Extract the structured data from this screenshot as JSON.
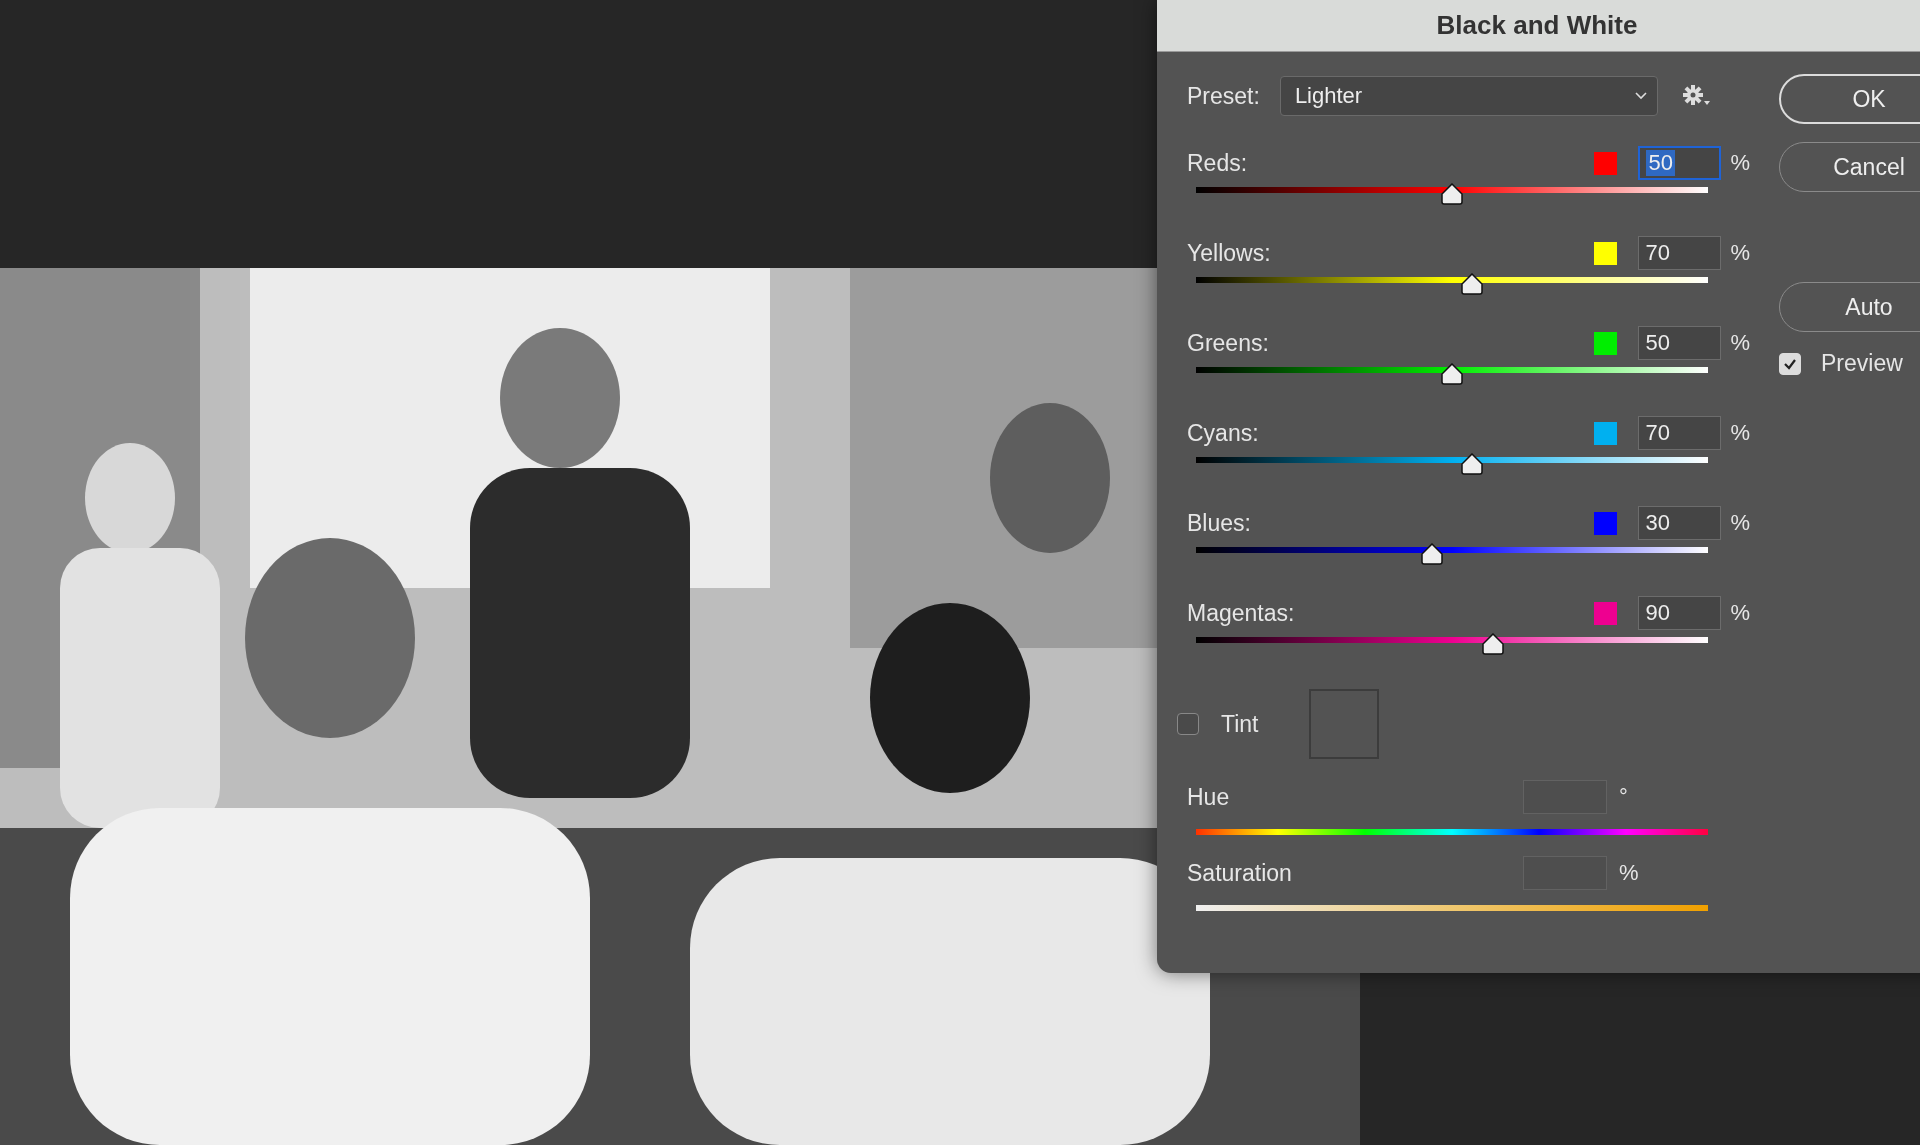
{
  "window": {
    "title": "Black and White"
  },
  "preset": {
    "label": "Preset:",
    "value": "Lighter"
  },
  "channels": [
    {
      "name": "Reds:",
      "color": "#ff0000",
      "value": "50",
      "unit": "%",
      "level": 0.5,
      "focused": true
    },
    {
      "name": "Yellows:",
      "color": "#ffff00",
      "value": "70",
      "unit": "%",
      "level": 0.54,
      "focused": false
    },
    {
      "name": "Greens:",
      "color": "#00ee00",
      "value": "50",
      "unit": "%",
      "level": 0.5,
      "focused": false
    },
    {
      "name": "Cyans:",
      "color": "#00b0f0",
      "value": "70",
      "unit": "%",
      "level": 0.54,
      "focused": false
    },
    {
      "name": "Blues:",
      "color": "#0000ff",
      "value": "30",
      "unit": "%",
      "level": 0.46,
      "focused": false
    },
    {
      "name": "Magentas:",
      "color": "#ee0090",
      "value": "90",
      "unit": "%",
      "level": 0.58,
      "focused": false
    }
  ],
  "tint": {
    "label": "Tint",
    "checked": false
  },
  "hue": {
    "label": "Hue",
    "unit": "°"
  },
  "saturation": {
    "label": "Saturation",
    "unit": "%"
  },
  "buttons": [
    {
      "label": "OK",
      "kind": "default"
    },
    {
      "label": "Cancel",
      "kind": "normal"
    },
    {
      "label": "Auto",
      "kind": "separate"
    }
  ],
  "preview": {
    "label": "Preview",
    "checked": true
  }
}
